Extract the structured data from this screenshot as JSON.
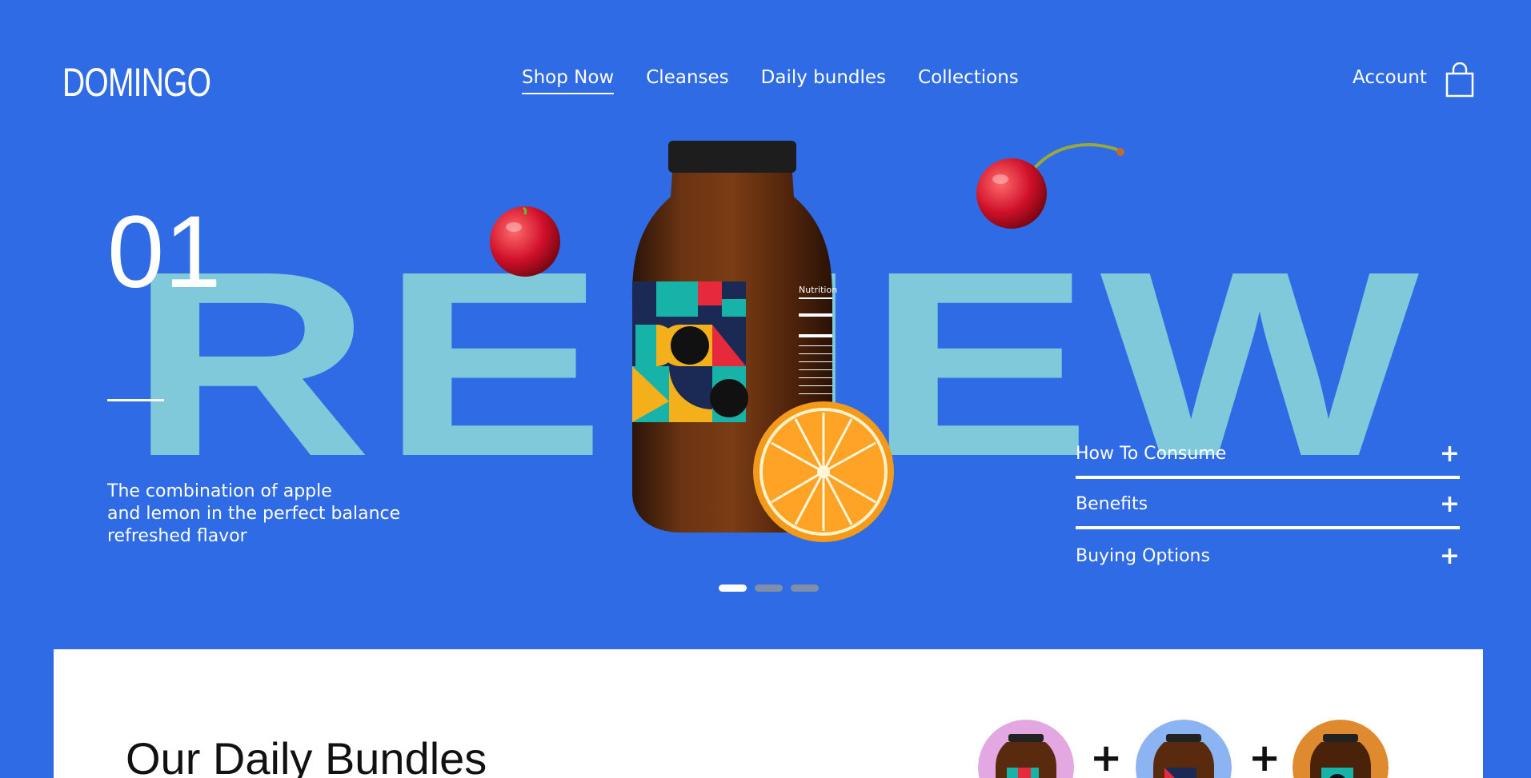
{
  "brand": {
    "logo": "DOMINGO"
  },
  "nav": {
    "items": [
      {
        "label": "Shop Now",
        "active": true
      },
      {
        "label": "Cleanses",
        "active": false
      },
      {
        "label": "Daily bundles",
        "active": false
      },
      {
        "label": "Collections",
        "active": false
      }
    ],
    "account": "Account",
    "cart_icon": "shopping-bag-icon"
  },
  "hero": {
    "big_word": "RENEW",
    "slide_number": "01",
    "description": [
      "The combination of apple",
      "and lemon in the perfect balance",
      "refreshed flavor"
    ],
    "bottle_label_text": "Nutrition"
  },
  "accordion": {
    "items": [
      {
        "label": "How To Consume",
        "icon": "plus-icon"
      },
      {
        "label": "Benefits",
        "icon": "plus-icon"
      },
      {
        "label": "Buying Options",
        "icon": "plus-icon"
      }
    ]
  },
  "carousel": {
    "slides": 3,
    "active_index": 0
  },
  "bundles": {
    "title": "Our Daily Bundles",
    "circle_colors": [
      "#e3a8e1",
      "#8db4f2",
      "#df8a2e"
    ],
    "separator": "+"
  },
  "colors": {
    "background": "#2f6be5",
    "big_word": "#80c9da",
    "panel": "#ffffff"
  }
}
